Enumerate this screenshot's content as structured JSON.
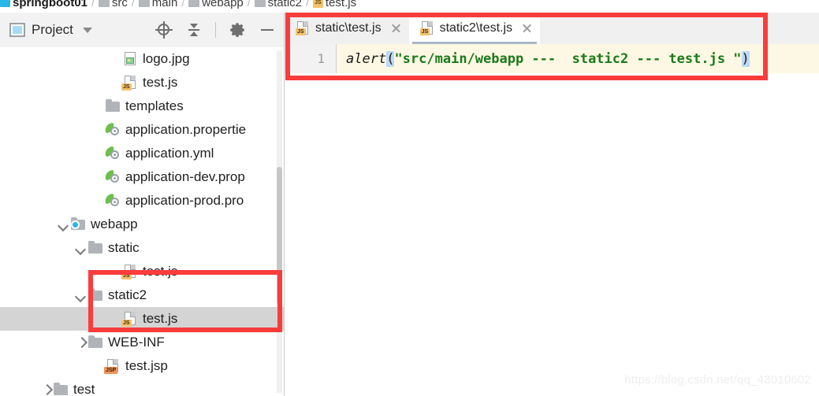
{
  "breadcrumb": {
    "items": [
      {
        "label": "springboot01",
        "icon": "module-icon"
      },
      {
        "label": "src",
        "icon": "folder-icon"
      },
      {
        "label": "main",
        "icon": "folder-icon"
      },
      {
        "label": "webapp",
        "icon": "folder-icon"
      },
      {
        "label": "static2",
        "icon": "folder-icon"
      },
      {
        "label": "test.js",
        "icon": "js-file-icon"
      }
    ],
    "separator": "/"
  },
  "project_panel": {
    "title": "Project",
    "title_icon": "project-view-icon",
    "dropdown_icon": "chevron-down-icon",
    "toolbar": [
      {
        "name": "locate-icon",
        "tooltip": "Select Opened File"
      },
      {
        "name": "collapse-all-icon",
        "tooltip": "Collapse All"
      },
      {
        "name": "gear-icon",
        "tooltip": "Settings"
      },
      {
        "name": "minimize-icon",
        "tooltip": "Hide"
      }
    ],
    "tree": [
      {
        "label": "logo.jpg",
        "icon": "image-file-icon",
        "badge": "",
        "indent": 6,
        "arrow": "none",
        "selected": false
      },
      {
        "label": "test.js",
        "icon": "js-file-icon",
        "badge": "JS",
        "indent": 6,
        "arrow": "none",
        "selected": false
      },
      {
        "label": "templates",
        "icon": "folder-icon",
        "badge": "",
        "indent": 5,
        "arrow": "none",
        "selected": false
      },
      {
        "label": "application.propertie",
        "icon": "spring-file-icon",
        "badge": "",
        "indent": 5,
        "arrow": "none",
        "selected": false
      },
      {
        "label": "application.yml",
        "icon": "spring-file-icon",
        "badge": "",
        "indent": 5,
        "arrow": "none",
        "selected": false
      },
      {
        "label": "application-dev.prop",
        "icon": "spring-file-icon",
        "badge": "",
        "indent": 5,
        "arrow": "none",
        "selected": false
      },
      {
        "label": "application-prod.pro",
        "icon": "spring-file-icon",
        "badge": "",
        "indent": 5,
        "arrow": "none",
        "selected": false
      },
      {
        "label": "webapp",
        "icon": "web-folder-icon",
        "badge": "",
        "indent": 3,
        "arrow": "down",
        "selected": false
      },
      {
        "label": "static",
        "icon": "folder-icon",
        "badge": "",
        "indent": 4,
        "arrow": "down",
        "selected": false
      },
      {
        "label": "test.js",
        "icon": "js-file-icon",
        "badge": "JS",
        "indent": 6,
        "arrow": "none",
        "selected": false
      },
      {
        "label": "static2",
        "icon": "folder-icon",
        "badge": "",
        "indent": 4,
        "arrow": "down",
        "selected": false
      },
      {
        "label": "test.js",
        "icon": "js-file-icon",
        "badge": "JS",
        "indent": 6,
        "arrow": "none",
        "selected": true
      },
      {
        "label": "WEB-INF",
        "icon": "folder-icon",
        "badge": "",
        "indent": 4,
        "arrow": "right",
        "selected": false
      },
      {
        "label": "test.jsp",
        "icon": "jsp-file-icon",
        "badge": "JSP",
        "indent": 5,
        "arrow": "none",
        "selected": false
      },
      {
        "label": "test",
        "icon": "folder-icon",
        "badge": "",
        "indent": 2,
        "arrow": "right",
        "selected": false
      }
    ]
  },
  "editor": {
    "tabs": [
      {
        "label": "static\\test.js",
        "icon": "js-file-icon",
        "close_icon": "close-icon",
        "active": false
      },
      {
        "label": "static2\\test.js",
        "icon": "js-file-icon",
        "close_icon": "close-icon",
        "active": true
      }
    ],
    "line_number": "1",
    "code": {
      "function_name": "alert",
      "open_paren": "(",
      "string": "\"src/main/webapp ---  static2 --- test.js \"",
      "close_paren": ")"
    }
  },
  "watermark": "https://blog.csdn.net/qq_43010602",
  "annotations": {
    "colors": {
      "highlight_rect": "#fa3c3c",
      "selection": "#d4d4d4",
      "code_bg": "#fdf8e3",
      "accent": "#29b6e8"
    },
    "boxes": [
      {
        "name": "editor-highlight-box"
      },
      {
        "name": "tree-static2-highlight-box"
      }
    ]
  }
}
